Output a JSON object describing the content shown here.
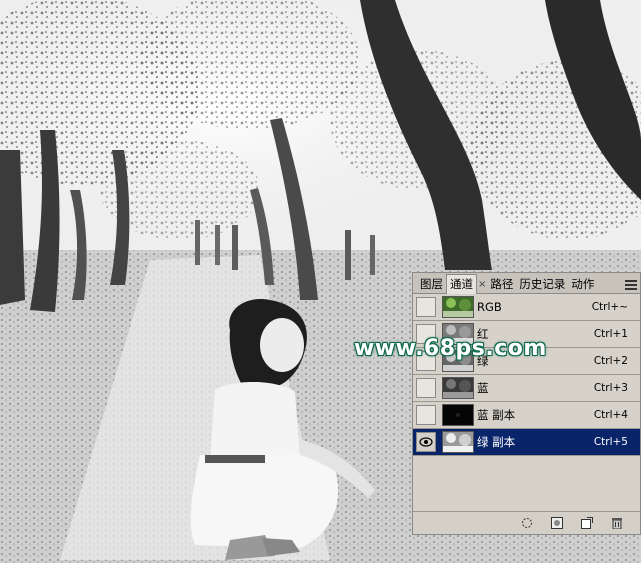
{
  "watermark": "www.68ps.com",
  "panel": {
    "tabs": [
      {
        "label": "图层",
        "active": false
      },
      {
        "label": "通道",
        "active": true
      },
      {
        "label": "路径",
        "active": false
      },
      {
        "label": "历史记录",
        "active": false
      },
      {
        "label": "动作",
        "active": false
      }
    ],
    "close_glyph": "×",
    "menu_icon": "panel-menu-icon",
    "channels": [
      {
        "name": "RGB",
        "shortcut": "Ctrl+~",
        "visible": false,
        "selected": false,
        "thumb": "color"
      },
      {
        "name": "红",
        "shortcut": "Ctrl+1",
        "visible": false,
        "selected": false,
        "thumb": "gray-light"
      },
      {
        "name": "绿",
        "shortcut": "Ctrl+2",
        "visible": false,
        "selected": false,
        "thumb": "gray-mid"
      },
      {
        "name": "蓝",
        "shortcut": "Ctrl+3",
        "visible": false,
        "selected": false,
        "thumb": "gray-dark"
      },
      {
        "name": "蓝 副本",
        "shortcut": "Ctrl+4",
        "visible": false,
        "selected": false,
        "thumb": "black"
      },
      {
        "name": "绿 副本",
        "shortcut": "Ctrl+5",
        "visible": true,
        "selected": true,
        "thumb": "gray-bright"
      }
    ],
    "footer_icons": [
      "load-selection-icon",
      "save-selection-icon",
      "new-channel-icon",
      "delete-channel-icon"
    ]
  },
  "colors": {
    "selection": "#0a246a",
    "watermark_outline": "#0f6b4e"
  }
}
